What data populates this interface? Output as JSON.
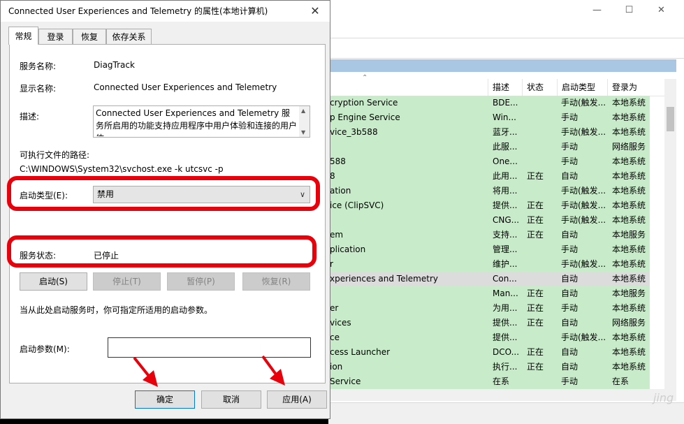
{
  "dialog": {
    "title": "Connected User Experiences and Telemetry 的属性(本地计算机)",
    "close_glyph": "✕",
    "tabs": [
      "常规",
      "登录",
      "恢复",
      "依存关系"
    ],
    "service_name_label": "服务名称:",
    "service_name_value": "DiagTrack",
    "display_name_label": "显示名称:",
    "display_name_value": "Connected User Experiences and Telemetry",
    "description_label": "描述:",
    "description_value": "Connected User Experiences and Telemetry 服务所启用的功能支持应用程序中用户体验和连接的用户体",
    "exe_path_label": "可执行文件的路径:",
    "exe_path_value": "C:\\WINDOWS\\System32\\svchost.exe -k utcsvc -p",
    "startup_type_label": "启动类型(E):",
    "startup_type_value": "禁用",
    "status_label": "服务状态:",
    "status_value": "已停止",
    "buttons": {
      "start": "启动(S)",
      "stop": "停止(T)",
      "pause": "暂停(P)",
      "resume": "恢复(R)"
    },
    "hint": "当从此处启动服务时，你可指定所适用的启动参数。",
    "params_label": "启动参数(M):",
    "params_value": "",
    "ok": "确定",
    "cancel": "取消",
    "apply": "应用(A)"
  },
  "services_window": {
    "minimize_glyph": "—",
    "maximize_glyph": "☐",
    "close_glyph": "✕",
    "sort_glyph": "⌃",
    "columns": [
      "描述",
      "状态",
      "启动类型",
      "登录为"
    ],
    "rows": [
      {
        "name": "cryption Service",
        "desc": "BDE...",
        "status": "",
        "startup": "手动(触发...",
        "logon": "本地系统"
      },
      {
        "name": "p Engine Service",
        "desc": "Win...",
        "status": "",
        "startup": "手动",
        "logon": "本地系统"
      },
      {
        "name": "vice_3b588",
        "desc": "蓝牙...",
        "status": "",
        "startup": "手动(触发...",
        "logon": "本地系统"
      },
      {
        "name": "",
        "desc": "此服...",
        "status": "",
        "startup": "手动",
        "logon": "网络服务"
      },
      {
        "name": "588",
        "desc": "One...",
        "status": "",
        "startup": "手动",
        "logon": "本地系统"
      },
      {
        "name": "8",
        "desc": "此用...",
        "status": "正在",
        "startup": "自动",
        "logon": "本地系统"
      },
      {
        "name": "ation",
        "desc": "将用...",
        "status": "",
        "startup": "手动(触发...",
        "logon": "本地系统"
      },
      {
        "name": "ice (ClipSVC)",
        "desc": "提供...",
        "status": "正在",
        "startup": "手动(触发...",
        "logon": "本地系统"
      },
      {
        "name": "",
        "desc": "CNG...",
        "status": "正在",
        "startup": "手动(触发...",
        "logon": "本地系统"
      },
      {
        "name": "em",
        "desc": "支持...",
        "status": "正在",
        "startup": "自动",
        "logon": "本地服务"
      },
      {
        "name": "plication",
        "desc": "管理...",
        "status": "",
        "startup": "手动",
        "logon": "本地系统"
      },
      {
        "name": "r",
        "desc": "维护...",
        "status": "",
        "startup": "手动(触发...",
        "logon": "本地系统"
      },
      {
        "name": "xperiences and Telemetry",
        "desc": "Con...",
        "status": "",
        "startup": "自动",
        "logon": "本地系统"
      },
      {
        "name": "",
        "desc": "Man...",
        "status": "正在",
        "startup": "自动",
        "logon": "本地服务"
      },
      {
        "name": "er",
        "desc": "为用...",
        "status": "正在",
        "startup": "手动",
        "logon": "本地系统"
      },
      {
        "name": "vices",
        "desc": "提供...",
        "status": "正在",
        "startup": "自动",
        "logon": "网络服务"
      },
      {
        "name": "ce",
        "desc": "提供...",
        "status": "",
        "startup": "手动(触发...",
        "logon": "本地系统"
      },
      {
        "name": "cess Launcher",
        "desc": "DCO...",
        "status": "正在",
        "startup": "自动",
        "logon": "本地系统"
      },
      {
        "name": "ion",
        "desc": "执行...",
        "status": "正在",
        "startup": "自动",
        "logon": "本地系统"
      },
      {
        "name": "Service",
        "desc": "在系",
        "status": "",
        "startup": "手动",
        "logon": "在系"
      }
    ],
    "selected_row_index": 12,
    "watermark": "jing"
  },
  "colors": {
    "highlight_red": "#e8000b",
    "row_green": "#c8ecc9",
    "header_blue": "#a9c6e2"
  }
}
